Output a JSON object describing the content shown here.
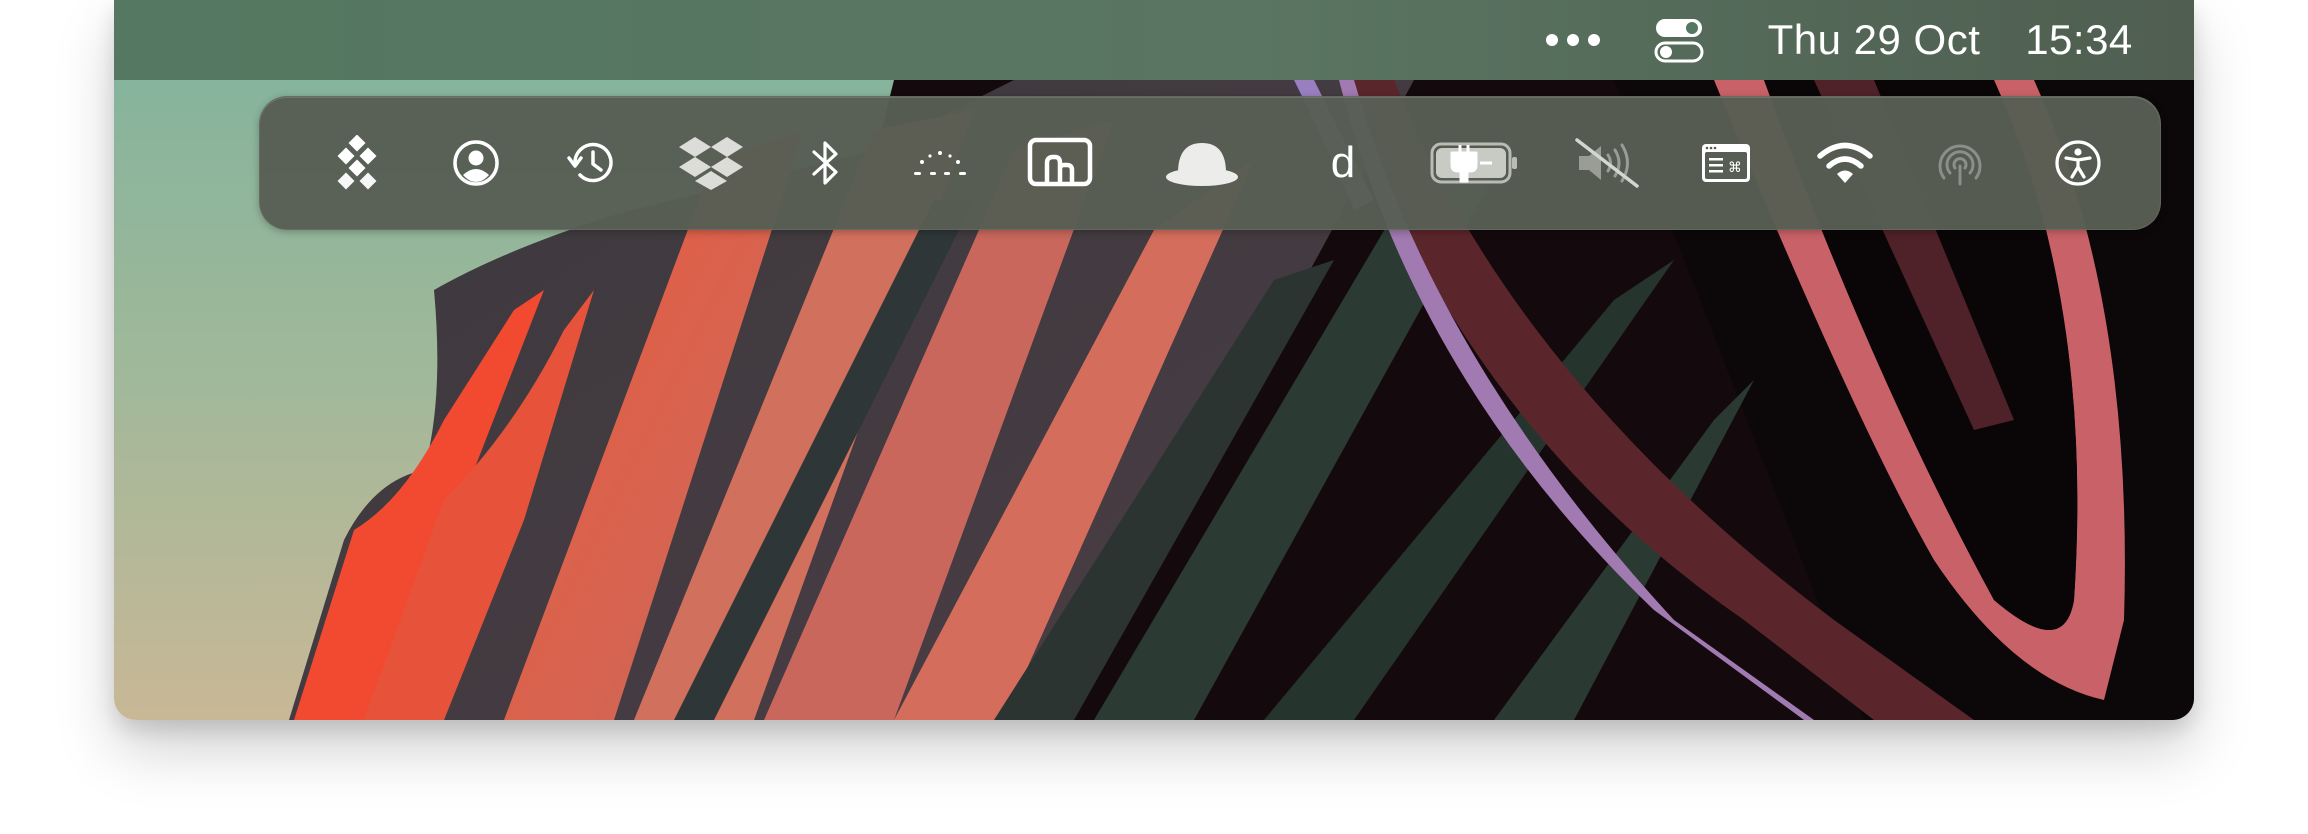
{
  "menubar": {
    "date": "Thu 29 Oct",
    "time": "15:34",
    "right_icons": [
      "more-dots-icon",
      "control-center-icon"
    ]
  },
  "overflow_menu": {
    "items": [
      {
        "name": "diamond-grid-icon"
      },
      {
        "name": "user-account-icon"
      },
      {
        "name": "time-machine-icon"
      },
      {
        "name": "dropbox-icon"
      },
      {
        "name": "bluetooth-icon"
      },
      {
        "name": "dotted-arc-icon"
      },
      {
        "name": "screen-mirroring-icon"
      },
      {
        "name": "hat-icon"
      },
      {
        "name": "letter-d-icon",
        "label": "d"
      },
      {
        "name": "battery-charging-icon"
      },
      {
        "name": "volume-muted-icon"
      },
      {
        "name": "keyboard-shortcuts-icon"
      },
      {
        "name": "wifi-icon"
      },
      {
        "name": "airdrop-icon"
      },
      {
        "name": "accessibility-icon"
      }
    ]
  },
  "colors": {
    "menubar_bg": "#547861",
    "overflow_bg": "#585e54",
    "icon": "#ffffff",
    "icon_dimmed": "#9a9d96"
  }
}
